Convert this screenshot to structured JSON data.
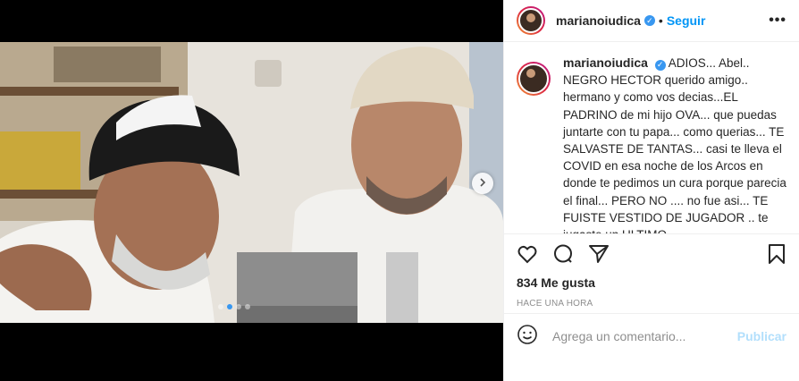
{
  "post": {
    "username": "marianoiudica",
    "follow_label": "Seguir",
    "separator": "•",
    "more_label": "•••",
    "caption": "ADIOS... Abel.. NEGRO HECTOR querido amigo.. hermano y como vos decias...EL PADRINO de mi hijo OVA... que puedas juntarte con tu papa... como querias... TE SALVASTE DE TANTAS... casi te lleva el COVID en esa noche de los Arcos en donde te pedimos un cura porque parecia el final... PERO NO .... no fue asi... TE FUISTE VESTIDO DE JUGADOR .. te jugaste un ULTIMO",
    "likes": "834 Me gusta",
    "time": "HACE UNA HORA",
    "comment_placeholder": "Agrega un comentario...",
    "publish_label": "Publicar",
    "carousel": {
      "slides": 4,
      "active": 2
    }
  },
  "icons": {
    "verified": "verified-badge-icon",
    "like": "heart-icon",
    "comment": "comment-icon",
    "share": "share-icon",
    "save": "bookmark-icon",
    "emoji": "emoji-icon",
    "next": "chevron-right-icon"
  },
  "colors": {
    "accent": "#0095f6",
    "publish_disabled": "#b2dffc",
    "muted": "#8e8e8e"
  }
}
